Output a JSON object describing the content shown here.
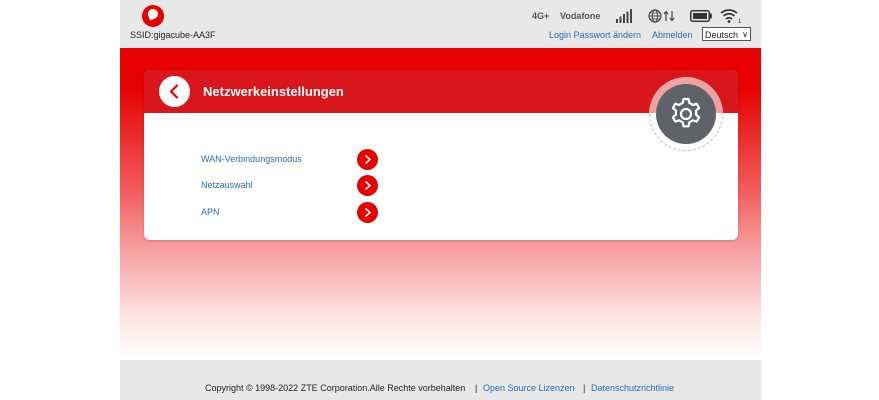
{
  "header": {
    "ssid": "SSID:gigacube-AA3F",
    "network_type": "4G+",
    "carrier": "Vodafone",
    "wifi_clients": "1",
    "login_link": "Login Passwort ändern",
    "logout_link": "Abmelden",
    "language": "Deutsch"
  },
  "card": {
    "title": "Netzwerkeinstellungen",
    "items": [
      {
        "label": "WAN-Verbindungsmodus"
      },
      {
        "label": "Netzauswahl"
      },
      {
        "label": "APN"
      }
    ]
  },
  "footer": {
    "copyright": "Copyright © 1998-2022 ZTE Corporation.Alle Rechte vorbehalten",
    "sep1": "|",
    "open_source": "Open Source Lizenzen",
    "sep2": "|",
    "privacy": "Datenschutzrichtlinie"
  },
  "colors": {
    "brand": "#e60000",
    "card_header": "#d9161c",
    "link": "#2a6bb3",
    "gear": "#5f6368"
  },
  "icons": {
    "logo": "vodafone-logo",
    "signal": "signal-bars-icon",
    "globe": "globe-icon",
    "battery": "battery-icon",
    "wifi": "wifi-icon",
    "back": "chevron-left-icon",
    "settings": "gear-icon",
    "item_arrow": "chevron-right-icon"
  }
}
